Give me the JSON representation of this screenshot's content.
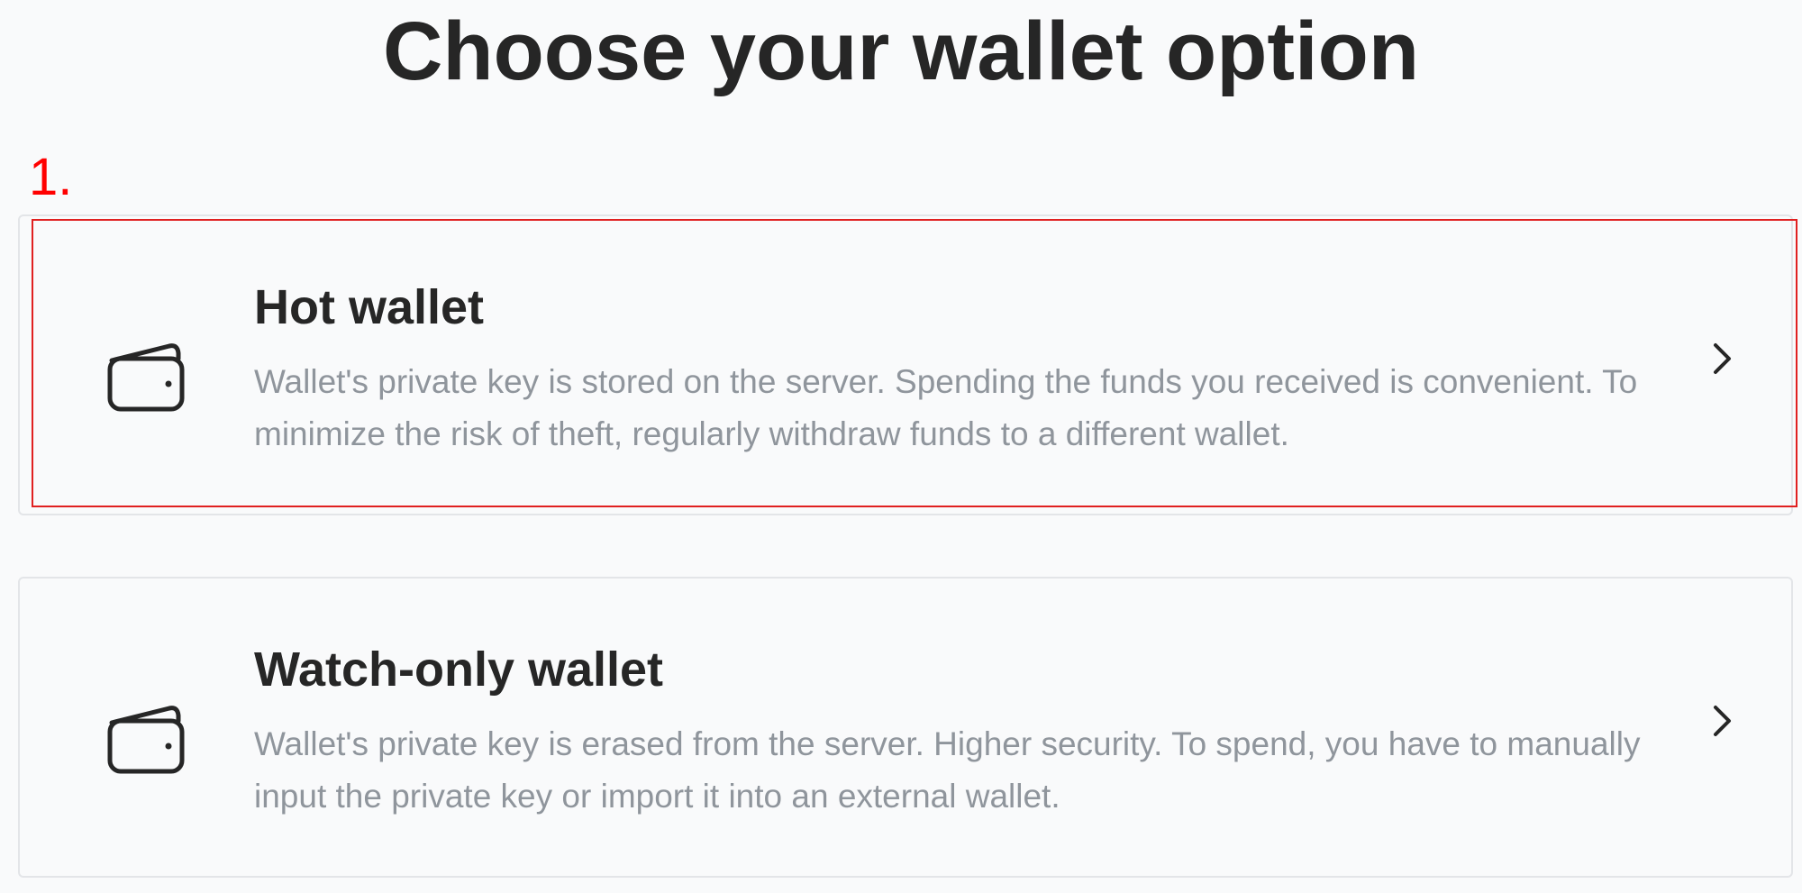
{
  "page": {
    "title": "Choose your wallet option"
  },
  "annotation": {
    "number": "1."
  },
  "options": [
    {
      "title": "Hot wallet",
      "description": "Wallet's private key is stored on the server. Spending the funds you received is convenient. To minimize the risk of theft, regularly withdraw funds to a different wallet.",
      "icon": "wallet-icon",
      "action_icon": "chevron-right-icon"
    },
    {
      "title": "Watch-only wallet",
      "description": "Wallet's private key is erased from the server. Higher security. To spend, you have to manually input the private key or import it into an external wallet.",
      "icon": "wallet-icon",
      "action_icon": "chevron-right-icon"
    }
  ],
  "colors": {
    "background": "#f9fafb",
    "title": "#262626",
    "description": "#8f959c",
    "card_border": "#e3e5e8",
    "highlight": "#e02020"
  }
}
